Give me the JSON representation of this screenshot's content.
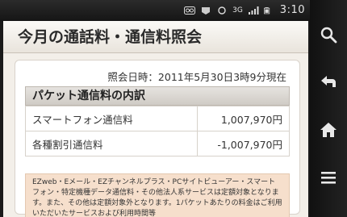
{
  "status": {
    "time": "3:10",
    "network": "3G"
  },
  "page": {
    "title": "今月の通話料・通信料照会"
  },
  "inquiry": {
    "text": "照会日時：2011年5月30日3時9分現在"
  },
  "section": {
    "title": "パケット通信料の内訳"
  },
  "rows": [
    {
      "label": "スマートフォン通信料",
      "value": "1,007,970円"
    },
    {
      "label": "各種割引通信料",
      "value": "-1,007,970円"
    }
  ],
  "notice": {
    "text": "EZweb・Eメール・EZチャンネルプラス・PCサイトビューアー・スマートフォン・特定機種データ通信料・その他法人系サービスは定額対象となります。また、その他は定額対象外となります。1パケットあたりの料金はご利用いただいたサービスおよび利用時間等"
  },
  "nav": {
    "search": "search-icon",
    "back": "back-arrow-icon",
    "home": "home-icon",
    "menu": "menu-icon"
  }
}
